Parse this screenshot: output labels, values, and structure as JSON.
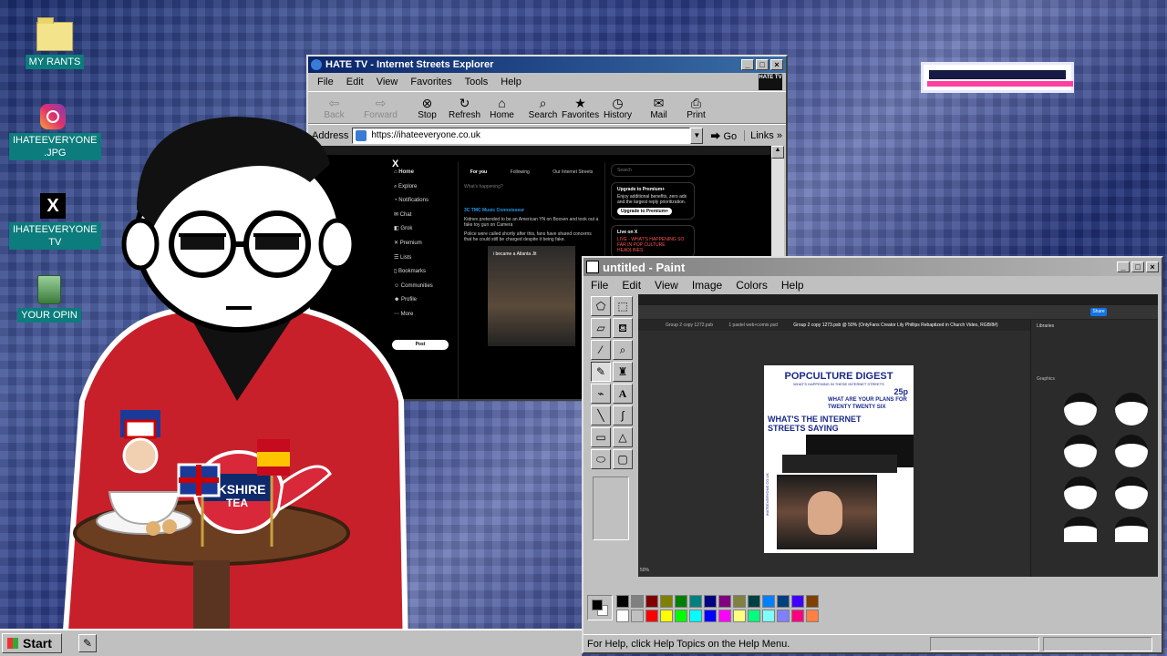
{
  "desktop": {
    "icons": [
      {
        "label": "MY RANTS",
        "icon": "folder-icon"
      },
      {
        "label": "IHATEEVERYONE\n.JPG",
        "icon": "instagram-icon"
      },
      {
        "label": "IHATEEVERYONE\nTV",
        "icon": "x-logo-icon"
      },
      {
        "label": "YOUR OPIN",
        "icon": "recycle-bin-icon"
      }
    ]
  },
  "ie": {
    "title": "HATE TV - Internet Streets Explorer",
    "menu": [
      "File",
      "Edit",
      "View",
      "Favorites",
      "Tools",
      "Help"
    ],
    "toolbar": [
      {
        "label": "Back",
        "glyph": "⇦",
        "disabled": true
      },
      {
        "label": "Forward",
        "glyph": "⇨",
        "disabled": true
      },
      {
        "label": "Stop",
        "glyph": "⊗",
        "disabled": false
      },
      {
        "label": "Refresh",
        "glyph": "↻",
        "disabled": false
      },
      {
        "label": "Home",
        "glyph": "⌂",
        "disabled": false
      },
      {
        "label": "Search",
        "glyph": "⌕",
        "disabled": false
      },
      {
        "label": "Favorites",
        "glyph": "★",
        "disabled": false
      },
      {
        "label": "History",
        "glyph": "◷",
        "disabled": false
      },
      {
        "label": "Mail",
        "glyph": "✉",
        "disabled": false
      },
      {
        "label": "Print",
        "glyph": "⎙",
        "disabled": false
      }
    ],
    "address_label": "Address",
    "address_value": "https://ihateeveryone.co.uk",
    "go_label": "Go",
    "links_label": "Links"
  },
  "xpage": {
    "nav": [
      "Home",
      "Explore",
      "Notifications",
      "Chat",
      "Grok",
      "Premium",
      "Lists",
      "Bookmarks",
      "Communities",
      "Profile",
      "More"
    ],
    "post_button": "Post",
    "tabs": [
      "For you",
      "Following",
      "Our Internet Streets"
    ],
    "search_placeholder": "Search",
    "compose_placeholder": "What's happening?",
    "post_author": "3C TMC Music Connoisseur",
    "post_body": "Kidnev pretended to be an American YN on Boxxen and took out a fake toy gun on Camera",
    "post_body2": "Police were called shortly after this, fans have shared concerns that he could still be charged despite it being fake.",
    "video_caption": "i became a Atlanta Jit",
    "premium_title": "Upgrade to Premium+",
    "premium_body": "Enjoy additional benefits, zero ads and the largest reply prioritization.",
    "premium_button": "Upgrade to Premium+",
    "live_title": "Live on X",
    "live_body": "LIVE - WHAT'S HAPPENING SO FAR IN POP CULTURE HEADLINES"
  },
  "paint": {
    "title": "untitled - Paint",
    "menu": [
      "File",
      "Edit",
      "View",
      "Image",
      "Colors",
      "Help"
    ],
    "status": "For Help, click Help Topics on the Help Menu.",
    "palette_top": [
      "#000000",
      "#808080",
      "#800000",
      "#808000",
      "#008000",
      "#008080",
      "#000080",
      "#800080",
      "#808040",
      "#004040",
      "#0080ff",
      "#004080",
      "#4000ff",
      "#804000"
    ],
    "palette_bottom": [
      "#ffffff",
      "#c0c0c0",
      "#ff0000",
      "#ffff00",
      "#00ff00",
      "#00ffff",
      "#0000ff",
      "#ff00ff",
      "#ffff80",
      "#00ff80",
      "#80ffff",
      "#8080ff",
      "#ff0080",
      "#ff8040"
    ]
  },
  "poster": {
    "title": "POPCULTURE DIGEST",
    "subtitle": "WHAT'S HAPPENING IN THESE INTERNET STREETS",
    "price": "25p",
    "headline1": "WHAT ARE YOUR PLANS FOR TWENTY TWENTY SIX",
    "headline2": "WHAT'S THE INTERNET STREETS SAYING",
    "side_text": "IHATEEVERYONE.CO.UK"
  },
  "photoshop": {
    "tab1": "Group 2 copy 1272.psb",
    "tab2": "1 pastel web+comix.psd",
    "tab3": "Group 2 copy 1273.psb @ 50% (OnlyFans Creator Lily Phillips Rebaptized in Church Video, RGB/8#)",
    "zoom": "50%",
    "panel_title": "Libraries",
    "panel_section": "Graphics",
    "share_label": "Share"
  },
  "taskbar": {
    "start": "Start"
  },
  "colors": {
    "title_active": "#0a246a",
    "desktop_label_bg": "#0c7c7c",
    "poster_blue": "#1a2a8a"
  }
}
